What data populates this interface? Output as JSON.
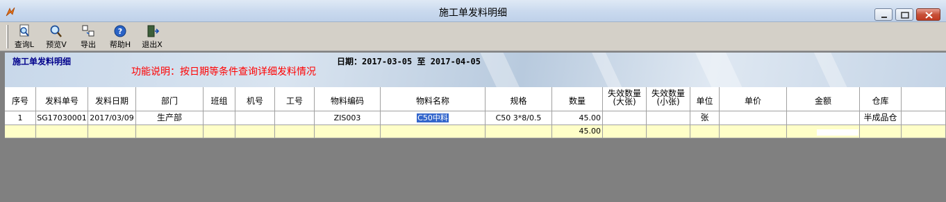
{
  "window": {
    "title": "施工单发料明细"
  },
  "toolbar": {
    "items": [
      {
        "label": "查询L",
        "icon": "query-icon"
      },
      {
        "label": "预览V",
        "icon": "preview-icon"
      },
      {
        "label": "导出",
        "icon": "export-icon"
      },
      {
        "label": "帮助H",
        "icon": "help-icon"
      },
      {
        "label": "退出X",
        "icon": "exit-icon"
      }
    ]
  },
  "banner": {
    "title": "施工单发料明细",
    "date_range": "日期：2017-03-05 至 2017-04-05",
    "description": "功能说明：按日期等条件查询详细发料情况"
  },
  "table": {
    "columns": [
      {
        "label": "序号"
      },
      {
        "label": "发料单号"
      },
      {
        "label": "发料日期"
      },
      {
        "label": "部门"
      },
      {
        "label": "班组"
      },
      {
        "label": "机号"
      },
      {
        "label": "工号"
      },
      {
        "label": "物料编码"
      },
      {
        "label": "物料名称"
      },
      {
        "label": "规格"
      },
      {
        "label": "数量"
      },
      {
        "label": "失效数量\n(大张)"
      },
      {
        "label": "失效数量\n(小张)"
      },
      {
        "label": "单位"
      },
      {
        "label": "单价"
      },
      {
        "label": "金额"
      },
      {
        "label": "仓库"
      }
    ],
    "rows": [
      {
        "seq": "1",
        "doc_no": "SG17030001",
        "date": "2017/03/09",
        "dept": "生产部",
        "team": "",
        "machine": "",
        "worker": "",
        "material_code": "ZIS003",
        "material_name": "C50中料",
        "spec": "C50 3*8/0.5",
        "qty": "45.00",
        "invalid_big": "",
        "invalid_small": "",
        "unit": "张",
        "price": "",
        "amount": "",
        "warehouse": "半成品仓"
      }
    ],
    "summary": {
      "qty_total": "45.00"
    }
  },
  "colors": {
    "background": "#808080",
    "summary_row": "#ffffc8",
    "header_title": "#00008b",
    "description": "#ff0000",
    "selection": "#3366cc"
  }
}
